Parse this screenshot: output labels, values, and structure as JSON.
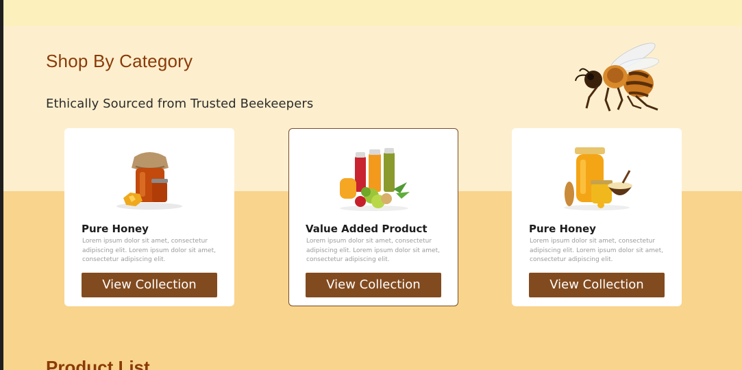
{
  "section": {
    "title": "Shop By Category",
    "subtitle": "Ethically Sourced from Trusted Beekeepers"
  },
  "cards": [
    {
      "title": "Pure Honey",
      "description": "Lorem ipsum dolor sit amet, consectetur adipiscing elit. Lorem ipsum dolor sit amet, consectetur adipiscing elit.",
      "button_label": "View Collection",
      "image": "honey-jar-with-honeycomb"
    },
    {
      "title": "Value Added Product",
      "description": "Lorem ipsum dolor sit amet, consectetur adipiscing elit. Lorem ipsum dolor sit amet, consectetur adipiscing elit.",
      "button_label": "View Collection",
      "image": "juice-bottles-and-fruits"
    },
    {
      "title": "Pure Honey",
      "description": "Lorem ipsum dolor sit amet, consectetur adipiscing elit. Lorem ipsum dolor sit amet, consectetur adipiscing elit.",
      "button_label": "View Collection",
      "image": "honey-jars-and-bowl"
    }
  ],
  "next_section": {
    "title": "Product List"
  },
  "colors": {
    "accent_brown": "#824b1f",
    "title_brown": "#8a3a08",
    "upper_bg": "#fdefce",
    "lower_bg": "#f9d48c",
    "top_bar": "#fcf0bd"
  },
  "decor": {
    "bee_image": "bee-illustration"
  }
}
